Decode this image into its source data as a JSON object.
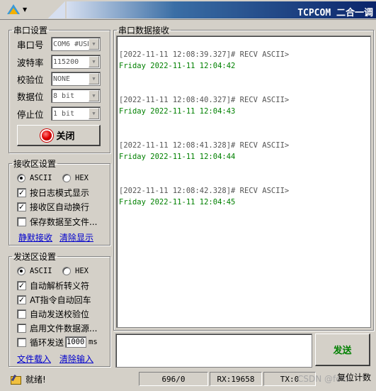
{
  "window": {
    "title": "TCPCOM 二合一调"
  },
  "serial": {
    "group_label": "串口设置",
    "port_label": "串口号",
    "port_value": "COM6 #USB",
    "baud_label": "波特率",
    "baud_value": "115200",
    "parity_label": "校验位",
    "parity_value": "NONE",
    "databits_label": "数据位",
    "databits_value": "8 bit",
    "stopbits_label": "停止位",
    "stopbits_value": "1 bit",
    "close_label": "关闭"
  },
  "receive_settings": {
    "group_label": "接收区设置",
    "ascii_label": "ASCII",
    "hex_label": "HEX",
    "mode": "ASCII",
    "log_mode_label": "按日志模式显示",
    "log_mode_checked": true,
    "auto_wrap_label": "接收区自动换行",
    "auto_wrap_checked": true,
    "save_file_label": "保存数据至文件...",
    "save_file_checked": false,
    "silent_recv_link": "静默接收",
    "clear_display_link": "清除显示"
  },
  "send_settings": {
    "group_label": "发送区设置",
    "ascii_label": "ASCII",
    "hex_label": "HEX",
    "mode": "ASCII",
    "auto_escape_label": "自动解析转义符",
    "auto_escape_checked": true,
    "at_newline_label": "AT指令自动回车",
    "at_newline_checked": true,
    "auto_checksum_label": "自动发送校验位",
    "auto_checksum_checked": false,
    "file_source_label": "启用文件数据源...",
    "file_source_checked": false,
    "loop_send_label": "循环发送",
    "loop_send_checked": false,
    "loop_interval": "1000",
    "loop_unit": "ms",
    "load_file_link": "文件载入",
    "clear_input_link": "清除输入"
  },
  "receive_panel": {
    "group_label": "串口数据接收",
    "entries": [
      {
        "header": "[2022-11-11 12:08:39.327]# RECV ASCII>",
        "body": "Friday 2022-11-11 12:04:42"
      },
      {
        "header": "[2022-11-11 12:08:40.327]# RECV ASCII>",
        "body": "Friday 2022-11-11 12:04:43"
      },
      {
        "header": "[2022-11-11 12:08:41.328]# RECV ASCII>",
        "body": "Friday 2022-11-11 12:04:44"
      },
      {
        "header": "[2022-11-11 12:08:42.328]# RECV ASCII>",
        "body": "Friday 2022-11-11 12:04:45"
      }
    ]
  },
  "send_panel": {
    "send_label": "发送",
    "input_value": ""
  },
  "status": {
    "ready_text": "就绪!",
    "counter": "696/0",
    "rx": "RX:19658",
    "tx": "TX:0",
    "reset_label": "复位计数",
    "watermark": "CSDN @fcitx"
  },
  "colors": {
    "recv_text": "#008000",
    "header_text": "#555555",
    "title_bar_end": "#0a246a"
  }
}
